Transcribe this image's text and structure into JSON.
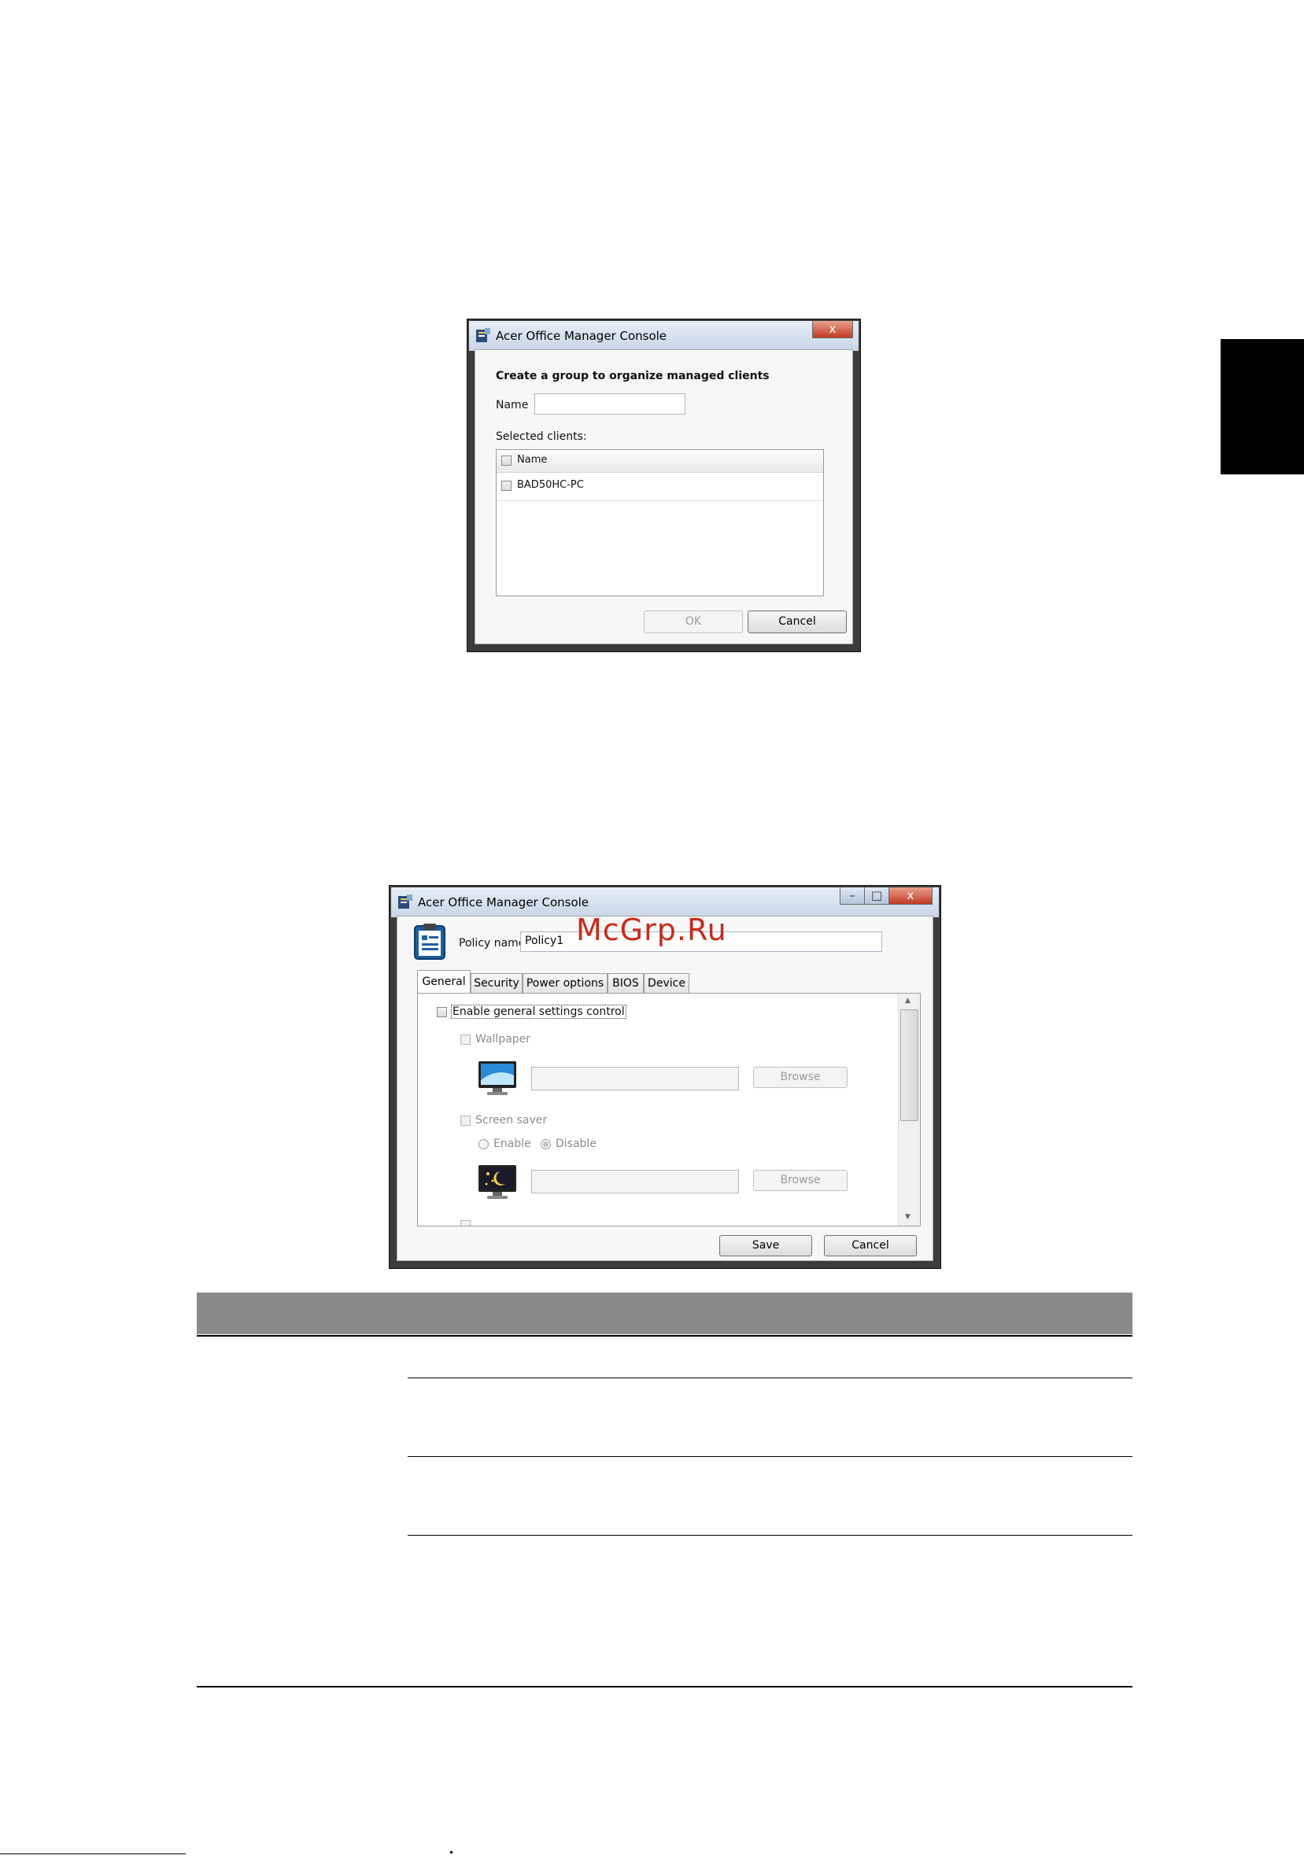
{
  "watermark": "McGrp.Ru",
  "dialog_group": {
    "title": "Acer Office Manager Console",
    "heading": "Create a group to organize managed clients",
    "name_label": "Name",
    "name_value": "",
    "selected_clients_label": "Selected clients:",
    "list_header": "Name",
    "clients": [
      "BAD50HC-PC"
    ],
    "ok_label": "OK",
    "cancel_label": "Cancel",
    "close_glyph": "x"
  },
  "dialog_policy": {
    "title": "Acer Office Manager Console",
    "policy_name_label": "Policy name",
    "policy_name_value": "Policy1",
    "tabs": [
      "General",
      "Security",
      "Power options",
      "BIOS",
      "Device"
    ],
    "active_tab": "General",
    "enable_general_label": "Enable general settings control",
    "wallpaper_label": "Wallpaper",
    "browse_label": "Browse",
    "screen_saver_label": "Screen saver",
    "enable_label": "Enable",
    "disable_label": "Disable",
    "save_label": "Save",
    "cancel_label": "Cancel",
    "minimize_glyph": "–",
    "maximize_glyph": "□",
    "close_glyph": "x"
  }
}
